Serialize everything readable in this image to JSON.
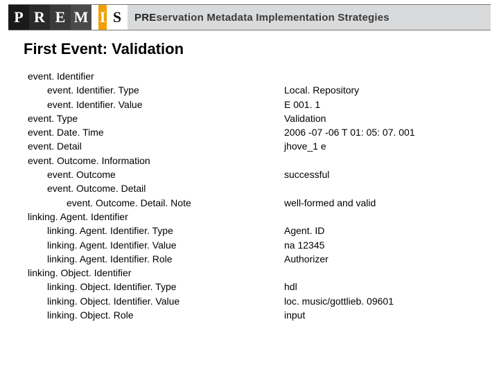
{
  "logo": {
    "letters": [
      "P",
      "R",
      "E",
      "M",
      "I",
      "S"
    ],
    "tagline_pre": "PRE",
    "tagline_rest": "servation Metadata Implementation Strategies"
  },
  "title": "First Event: Validation",
  "left": [
    {
      "t": "event. Identifier",
      "i": 0
    },
    {
      "t": "event. Identifier. Type",
      "i": 1
    },
    {
      "t": "event. Identifier. Value",
      "i": 1
    },
    {
      "t": "event. Type",
      "i": 0
    },
    {
      "t": "event. Date. Time",
      "i": 0
    },
    {
      "t": "event. Detail",
      "i": 0
    },
    {
      "t": "event. Outcome. Information",
      "i": 0
    },
    {
      "t": "event. Outcome",
      "i": 1
    },
    {
      "t": "event. Outcome. Detail",
      "i": 1
    },
    {
      "t": "event. Outcome. Detail. Note",
      "i": 2
    },
    {
      "t": "linking. Agent. Identifier",
      "i": 0
    },
    {
      "t": "linking. Agent. Identifier. Type",
      "i": 1
    },
    {
      "t": "linking. Agent. Identifier. Value",
      "i": 1
    },
    {
      "t": "linking. Agent. Identifier. Role",
      "i": 1
    },
    {
      "t": "linking. Object. Identifier",
      "i": 0
    },
    {
      "t": "linking. Object. Identifier. Type",
      "i": 1
    },
    {
      "t": "linking. Object. Identifier. Value",
      "i": 1
    },
    {
      "t": "linking. Object. Role",
      "i": 1
    }
  ],
  "right": [
    "",
    "Local. Repository",
    "E 001. 1",
    "Validation",
    "2006 -07 -06 T 01: 05: 07. 001",
    "jhove_1 e",
    "",
    "successful",
    "",
    "well-formed and valid",
    "",
    "Agent. ID",
    "na 12345",
    "Authorizer",
    "",
    "hdl",
    "loc. music/gottlieb. 09601",
    "input"
  ]
}
